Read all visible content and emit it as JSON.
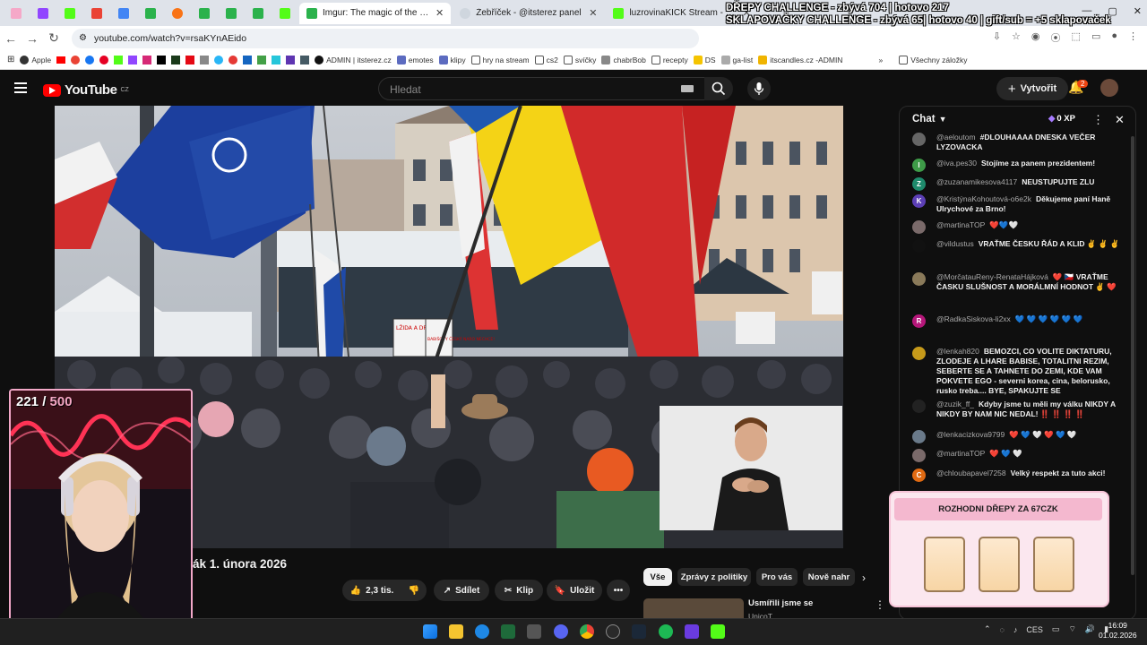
{
  "browser": {
    "tabs": [
      {
        "title": "Imgur: The magic of the Internet",
        "color": "#2bb24c",
        "active": false
      },
      {
        "title": "Žebříček - @itsterez panel",
        "color": "#cfd6de",
        "active": false
      },
      {
        "title": "luzrovinaKICK Stream - Watch Live",
        "color": "#53fc18",
        "active": false
      }
    ],
    "url": "youtube.com/watch?v=rsaKYnAEido",
    "bookmarks": [
      "Apple",
      "ADMIN | itsterez.cz",
      "emotes",
      "klipy",
      "hry na stream",
      "cs2",
      "svíčky",
      "chabrBob",
      "recepty",
      "DS",
      "ga-list",
      "itscandles.cz -ADMIN",
      "Všechny záložky"
    ]
  },
  "overlay": {
    "line1": "DŘEPY CHALLENGE - zbývá 704 | hotovo 217",
    "line2": "SKLAPOVAČKY CHALLENGE - zbývá 65| hotovo 40 | gift/sub = +5 sklapovaček"
  },
  "youtube": {
    "logo": "YouTube",
    "logo_country": "CZ",
    "search_placeholder": "Hledat",
    "create_label": "Vytvořit",
    "notifications": "2"
  },
  "video": {
    "title_visible": "ák 1. února 2026",
    "sign_text_1": "LŽIDA A DRD",
    "sign_text_2": "BABIŠOVY ČESKÝ NARO NECHCE!"
  },
  "actions": {
    "likes": "2,3 tis.",
    "share": "Sdílet",
    "clip": "Klip",
    "save": "Uložit"
  },
  "chips": [
    "Vše",
    "Zprávy z politiky",
    "Pro vás",
    "Nově nahr"
  ],
  "related": {
    "title": "Usmířili jsme se",
    "channel": "UnicoT"
  },
  "cam": {
    "count": "221 /",
    "max": "500"
  },
  "chat": {
    "title": "Chat",
    "xp": "0 XP",
    "messages": [
      {
        "user": "@aeloutom",
        "text": "#DLOUHAAAA DNESKA VEČER LYZOVACKA",
        "color": "#666"
      },
      {
        "user": "@iva.pes30",
        "text": "Stojíme za panem prezidentem!",
        "color": "#3e9b48",
        "initial": "I"
      },
      {
        "user": "@zuzanamikesova4117",
        "text": "NEUSTUPUJTE ZLU",
        "color": "#1e8a6c",
        "initial": "Z"
      },
      {
        "user": "@KristýnaKohoutová-o6e2k",
        "text": "Děkujeme paní Haně Ulrychové za Brno!",
        "color": "#5c3fb5",
        "initial": "K"
      },
      {
        "user": "@martinaTOP",
        "text": "❤️💙🤍",
        "color": "#7a6a6a"
      },
      {
        "user": "@vildustus",
        "text": "VRAŤME ČESKU ŘÁD A KLID ✌️ ✌️ ✌️",
        "color": "#111"
      },
      {
        "user": "@MorčatauReny-RenataHájková",
        "text": "❤️ 🇨🇿 VRAŤME ČASKU SLUŠNOST A MORÁLMNÍ HODNOT ✌️ ❤️",
        "color": "#8a7a5a"
      },
      {
        "user": "@RadkaSiskova-li2xx",
        "text": "💙 💙 💙 💙 💙 💙",
        "color": "#b5177a",
        "initial": "R"
      },
      {
        "user": "@lenkah820",
        "text": "BEMOZCI, CO VOLITE DIKTATURU, ZLODEJE A LHARE BABISE, TOTALITNI REZIM, SEBERTE SE A TAHNETE DO ZEMI, KDE VAM POKVETE EGO - severni korea, cina, belorusko, rusko treba.... BYE, SPAKUJTE SE",
        "color": "#c69a1a"
      },
      {
        "user": "@zuzik_ff_",
        "text": "Kdyby jsme tu měli my válku NIKDY A NIKDY BY NAM NIC NEDAL! ‼️ ‼️ ‼️ ‼️",
        "color": "#222"
      },
      {
        "user": "@lenkacizkova9799",
        "text": "❤️ 💙 🤍 ❤️ 💙 🤍",
        "color": "#6a7a8a"
      },
      {
        "user": "@martinaTOP",
        "text": "❤️ 💙 🤍",
        "color": "#7a6a6a"
      },
      {
        "user": "@chloubapavel7258",
        "text": "Velký respekt za tuto akci!",
        "color": "#e06a12",
        "initial": "C"
      }
    ]
  },
  "popup": {
    "title": "ROZHODNI DŘEPY ZA 67CZK"
  },
  "taskbar": {
    "time": "16:09",
    "date": "01.02.2026",
    "lang": "CES"
  }
}
